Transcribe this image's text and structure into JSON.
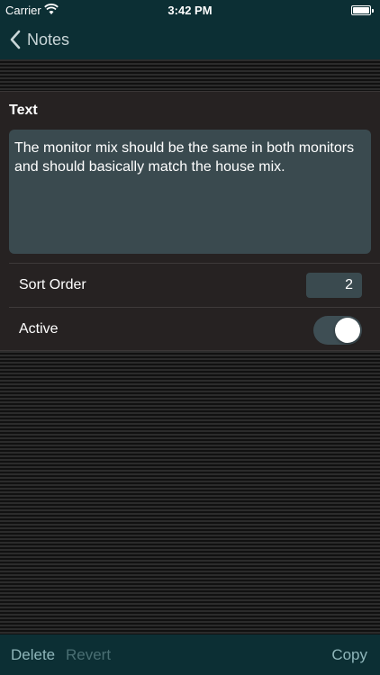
{
  "status_bar": {
    "carrier": "Carrier",
    "time": "3:42 PM",
    "battery_level": 1.0
  },
  "nav": {
    "back_label": "Notes",
    "back_icon": "chevron-left-icon"
  },
  "form": {
    "text_section_label": "Text",
    "text_value": "The monitor mix should be the same in both monitors and should basically match the house mix.",
    "sort_order_label": "Sort Order",
    "sort_order_value": "2",
    "active_label": "Active",
    "active_value": true
  },
  "toolbar": {
    "delete_label": "Delete",
    "revert_label": "Revert",
    "copy_label": "Copy"
  },
  "colors": {
    "bar_background": "#0c2f34",
    "accent": "#8fb6ba",
    "field_background": "#3a4a4f"
  }
}
